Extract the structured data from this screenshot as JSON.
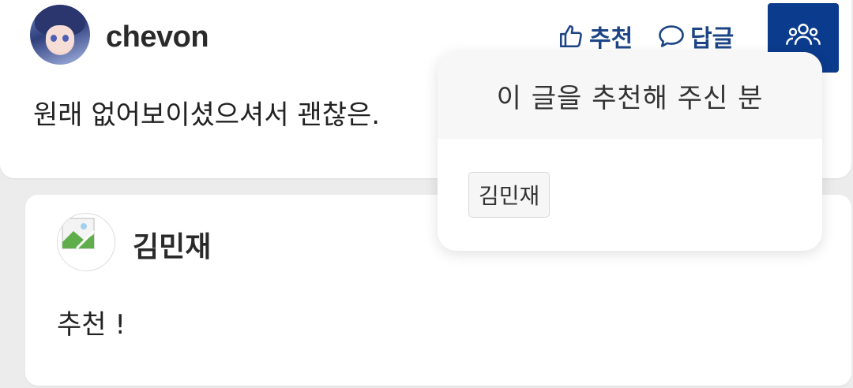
{
  "top_comment": {
    "username": "chevon",
    "body": "원래 없어보이셨으셔서 괜찮은.",
    "actions": {
      "like_label": "추천",
      "reply_label": "답글"
    },
    "avatar_icon": "anime-girl-avatar",
    "people_button_icon": "people-icon"
  },
  "popover": {
    "title": "이 글을 추천해 주신 분",
    "users": [
      "김민재"
    ]
  },
  "reply_comment": {
    "username": "김민재",
    "body": "추천 !",
    "avatar_icon": "broken-image-icon"
  },
  "colors": {
    "accent": "#1d4585",
    "people_button_bg": "#0b3b8c",
    "page_bg": "#ececec"
  }
}
